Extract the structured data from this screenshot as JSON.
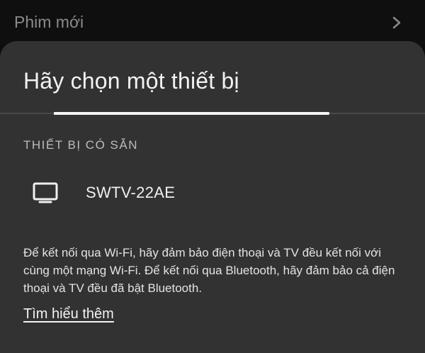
{
  "background": {
    "title": "Phim mới",
    "chevron_icon": "chevron-right-icon"
  },
  "dialog": {
    "title": "Hãy chọn một thiết bị",
    "progress_indeterminate": true,
    "section_header": "THIẾT BỊ CÓ SẴN",
    "devices": [
      {
        "icon": "tv-icon",
        "name": "SWTV-22AE"
      }
    ],
    "help_text": "Để kết nối qua Wi-Fi, hãy đảm bảo điện thoại và TV đều kết nối với cùng một mạng Wi-Fi. Để kết nối qua Bluetooth, hãy đảm bảo cả điện thoại và TV đều đã bật Bluetooth.",
    "learn_more": "Tìm hiểu thêm"
  },
  "colors": {
    "sheet": "#323232",
    "text_primary": "#f2f2f2",
    "text_secondary": "#bcbcbc",
    "background": "#0d0d0d"
  }
}
